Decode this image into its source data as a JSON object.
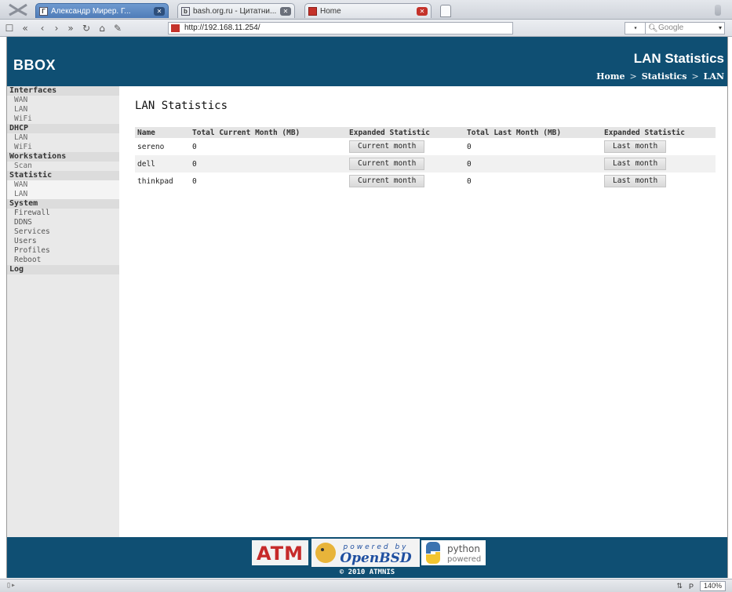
{
  "browser": {
    "tabs": [
      {
        "label": "Александр Мирер. Г...",
        "active": true
      },
      {
        "label": "bash.org.ru - Цитатни...",
        "active": false
      },
      {
        "label": "Home",
        "active": false
      }
    ],
    "address": "http://192.168.11.254/",
    "search_engine_label": "Google",
    "zoom": "140%"
  },
  "header": {
    "brand": "BBOX",
    "title": "LAN Statistics",
    "breadcrumb": [
      "Home",
      "Statistics",
      "LAN"
    ]
  },
  "sidebar": {
    "interfaces": {
      "label": "Interfaces",
      "items": [
        "WAN",
        "LAN",
        "WiFi"
      ]
    },
    "dhcp": {
      "label": "DHCP",
      "items": [
        "LAN",
        "WiFi"
      ]
    },
    "workstations": {
      "label": "Workstations",
      "items": [
        "Scan"
      ]
    },
    "statistic": {
      "label": "Statistic",
      "items": [
        "WAN",
        "LAN"
      ]
    },
    "system": {
      "label": "System",
      "items": [
        "Firewall",
        "DDNS",
        "Services",
        "Users",
        "Profiles",
        "Reboot"
      ]
    },
    "log": {
      "label": "Log"
    }
  },
  "main": {
    "title": "LAN Statistics",
    "columns": [
      "Name",
      "Total Current Month (MB)",
      "Expanded Statistic",
      "Total Last Month (MB)",
      "Expanded Statistic"
    ],
    "rows": [
      {
        "name": "sereno",
        "current": "0",
        "current_btn": "Current month",
        "last": "0",
        "last_btn": "Last month"
      },
      {
        "name": "dell",
        "current": "0",
        "current_btn": "Current month",
        "last": "0",
        "last_btn": "Last month"
      },
      {
        "name": "thinkpad",
        "current": "0",
        "current_btn": "Current month",
        "last": "0",
        "last_btn": "Last month"
      }
    ]
  },
  "footer": {
    "powered_by": "powered by",
    "openbsd": "OpenBSD",
    "python_line1": "python",
    "python_line2": "powered",
    "atmnis_logo_text": "ATM",
    "copyright": "© 2010 ATMNIS"
  },
  "colors": {
    "header_bg": "#0f4f73",
    "sidebar_bg": "#e9e9e9"
  }
}
